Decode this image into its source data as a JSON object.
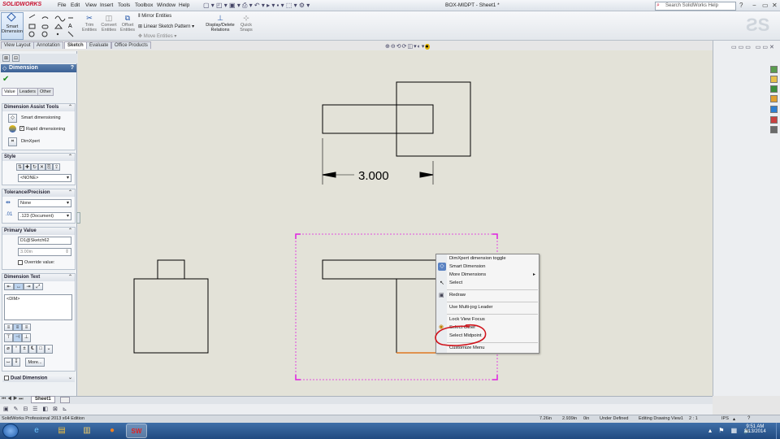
{
  "app": {
    "logo": "SOLIDWORKS",
    "menus": [
      "File",
      "Edit",
      "View",
      "Insert",
      "Tools",
      "Toolbox",
      "Window",
      "Help"
    ],
    "doc_title": "BOX-MIDPT - Sheet1 *",
    "search_placeholder": "Search SolidWorks Help"
  },
  "ribbon": {
    "smart_dimension": "Smart Dimension",
    "trim": "Trim Entities",
    "convert": "Convert Entities",
    "offset": "Offset Entities",
    "mirror": "Mirror Entities",
    "linear_pattern": "Linear Sketch Pattern",
    "move": "Move Entities",
    "display_delete": "Display/Delete Relations",
    "quick_snaps": "Quick Snaps"
  },
  "cm_tabs": [
    "View Layout",
    "Annotation",
    "Sketch",
    "Evaluate",
    "Office Products"
  ],
  "cm_active_tab": "Sketch",
  "property_manager": {
    "title": "Dimension",
    "help": "?",
    "tabs": [
      "Value",
      "Leaders",
      "Other"
    ],
    "assist_tools": {
      "header": "Dimension Assist Tools",
      "smart": "Smart dimensioning",
      "rapid": "Rapid dimensioning",
      "dimxpert": "DimXpert"
    },
    "style": {
      "header": "Style",
      "value": "<NONE>"
    },
    "tolerance": {
      "header": "Tolerance/Precision",
      "tol": "None",
      "precision": ".123 (Document)"
    },
    "primary": {
      "header": "Primary Value",
      "name": "D1@Sketch62",
      "value": "3.00in",
      "override": "Override value:"
    },
    "dim_text": {
      "header": "Dimension Text",
      "text": "<DIM>",
      "more": "More..."
    },
    "dual": {
      "header": "Dual Dimension"
    }
  },
  "drawing": {
    "dimension_value": "3.000"
  },
  "context_menu": {
    "items": [
      "DimXpert dimension toggle",
      "Smart Dimension",
      "More Dimensions",
      "Select",
      "Redraw",
      "Use Multi-jog Leader",
      "Lock View Focus",
      "Select Other",
      "Select Midpoint",
      "Customize Menu"
    ]
  },
  "sheet_tab": "Sheet1",
  "status": {
    "edition": "SolidWorks Professional 2013 x64 Edition",
    "x": "7.26in",
    "y": "2.939in",
    "z": "0in",
    "state": "Under Defined",
    "editing": "Editing Drawing View1",
    "scale": "2 : 1",
    "units": "IPS"
  },
  "taskbar": {
    "time": "9:51 AM",
    "date": "8/13/2014"
  },
  "colors": {
    "accent": "#3c6195",
    "selection": "#e020e0",
    "highlight": "#e07820",
    "annotation_circle": "#d0141c"
  }
}
